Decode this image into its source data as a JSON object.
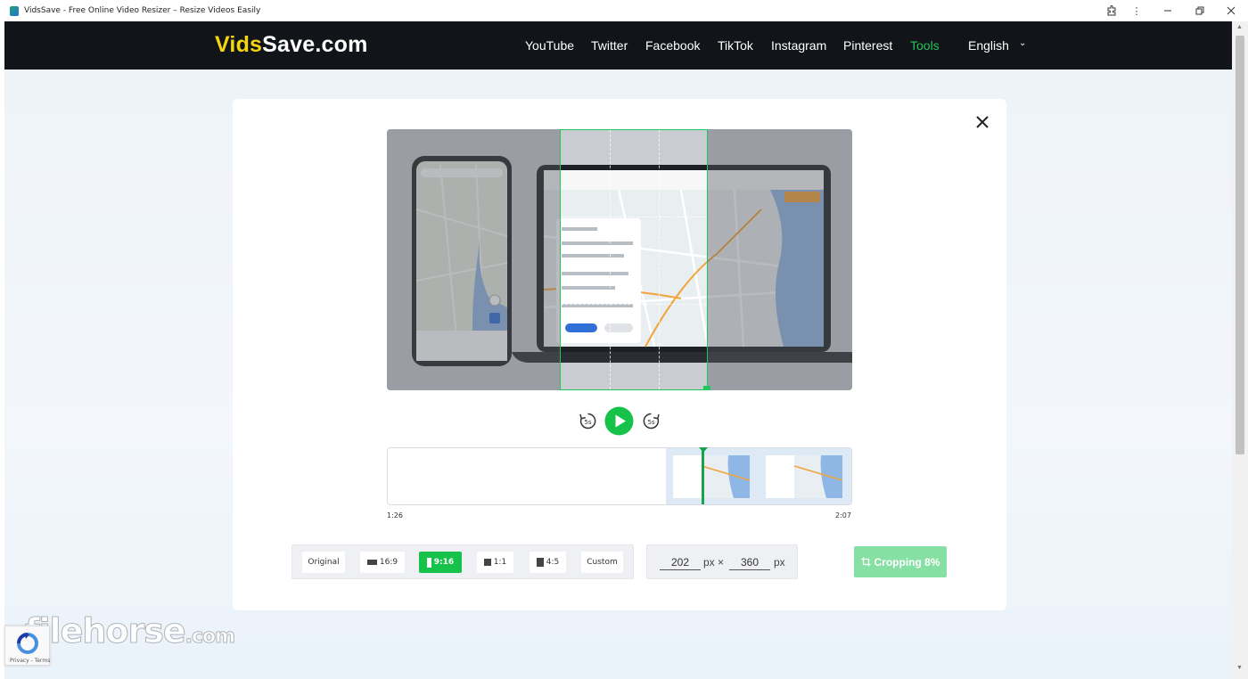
{
  "window": {
    "title": "VidsSave - Free Online Video Resizer – Resize Videos Easily"
  },
  "site": {
    "logo_part1": "Vids",
    "logo_part2": "Save.com"
  },
  "nav": {
    "items": [
      {
        "label": "YouTube",
        "active": false
      },
      {
        "label": "Twitter",
        "active": false
      },
      {
        "label": "Facebook",
        "active": false
      },
      {
        "label": "TikTok",
        "active": false
      },
      {
        "label": "Instagram",
        "active": false
      },
      {
        "label": "Pinterest",
        "active": false
      },
      {
        "label": "Tools",
        "active": true
      }
    ],
    "language": "English"
  },
  "player": {
    "rewind_label": "5s",
    "forward_label": "5s",
    "state": "paused"
  },
  "timeline": {
    "start_time": "1:26",
    "end_time": "2:07"
  },
  "ratios": {
    "selected": "9:16",
    "items": [
      {
        "label": "Original",
        "icon": ""
      },
      {
        "label": "16:9",
        "icon": "landscape-icon"
      },
      {
        "label": "9:16",
        "icon": "portrait-icon"
      },
      {
        "label": "1:1",
        "icon": "square-icon"
      },
      {
        "label": "4:5",
        "icon": "portrait-icon"
      },
      {
        "label": "Custom",
        "icon": ""
      }
    ]
  },
  "size": {
    "width": "202",
    "height": "360",
    "unit": "px",
    "separator": "×"
  },
  "action": {
    "crop_label": "Cropping 8%",
    "progress_percent": 8
  },
  "watermark": {
    "text": "filehorse",
    "suffix": ".com"
  },
  "recaptcha": {
    "text": "Privacy - Terms"
  },
  "colors": {
    "accent": "#22c55e",
    "nav_bg": "#111418",
    "logo_yellow": "#f5d50d"
  }
}
